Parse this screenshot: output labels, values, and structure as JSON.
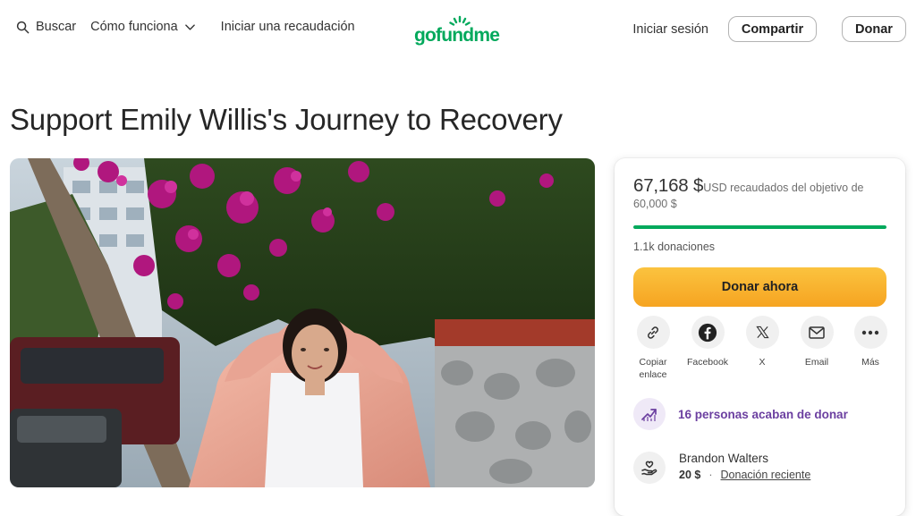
{
  "header": {
    "search_label": "Buscar",
    "how_it_works_label": "Cómo funciona",
    "start_fundraiser_label": "Iniciar una recaudación",
    "logo_text": "gofundme",
    "login_label": "Iniciar sesión",
    "share_label": "Compartir",
    "donate_label": "Donar",
    "brand_color": "#02a95c"
  },
  "campaign": {
    "title": "Support Emily Willis's Journey to Recovery"
  },
  "card": {
    "raised_amount": "67,168 $",
    "raised_text": "USD recaudados del objetivo de 60,000 $",
    "progress_percent": 100,
    "donations_count": "1.1k donaciones",
    "donate_now_label": "Donar ahora",
    "share_options": [
      {
        "label": "Copiar enlace",
        "icon": "link-icon"
      },
      {
        "label": "Facebook",
        "icon": "facebook-icon"
      },
      {
        "label": "X",
        "icon": "x-icon"
      },
      {
        "label": "Email",
        "icon": "email-icon"
      },
      {
        "label": "Más",
        "icon": "more-icon"
      }
    ],
    "recent_activity": "16 personas acaban de donar",
    "donor": {
      "name": "Brandon Walters",
      "amount": "20 $",
      "separator": "·",
      "tag": "Donación reciente"
    },
    "accent_color": "#6b3fa0",
    "button_color": "#f6a421"
  }
}
